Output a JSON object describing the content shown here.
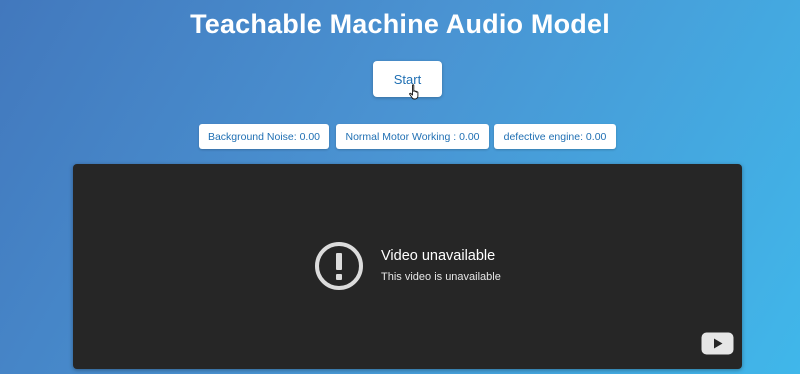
{
  "page": {
    "title": "Teachable Machine Audio Model"
  },
  "controls": {
    "start_label": "Start"
  },
  "predictions": [
    {
      "label": "Background Noise: 0.00"
    },
    {
      "label": "Normal Motor Working : 0.00"
    },
    {
      "label": "defective engine: 0.00"
    }
  ],
  "video": {
    "title": "Video unavailable",
    "message": "This video is unavailable",
    "warning_icon": "exclamation-circle-icon",
    "logo_icon": "youtube-icon"
  },
  "colors": {
    "background_start": "#4278bd",
    "background_end": "#40b7ea",
    "accent_text": "#1f6fb3",
    "video_bg": "#262626"
  }
}
